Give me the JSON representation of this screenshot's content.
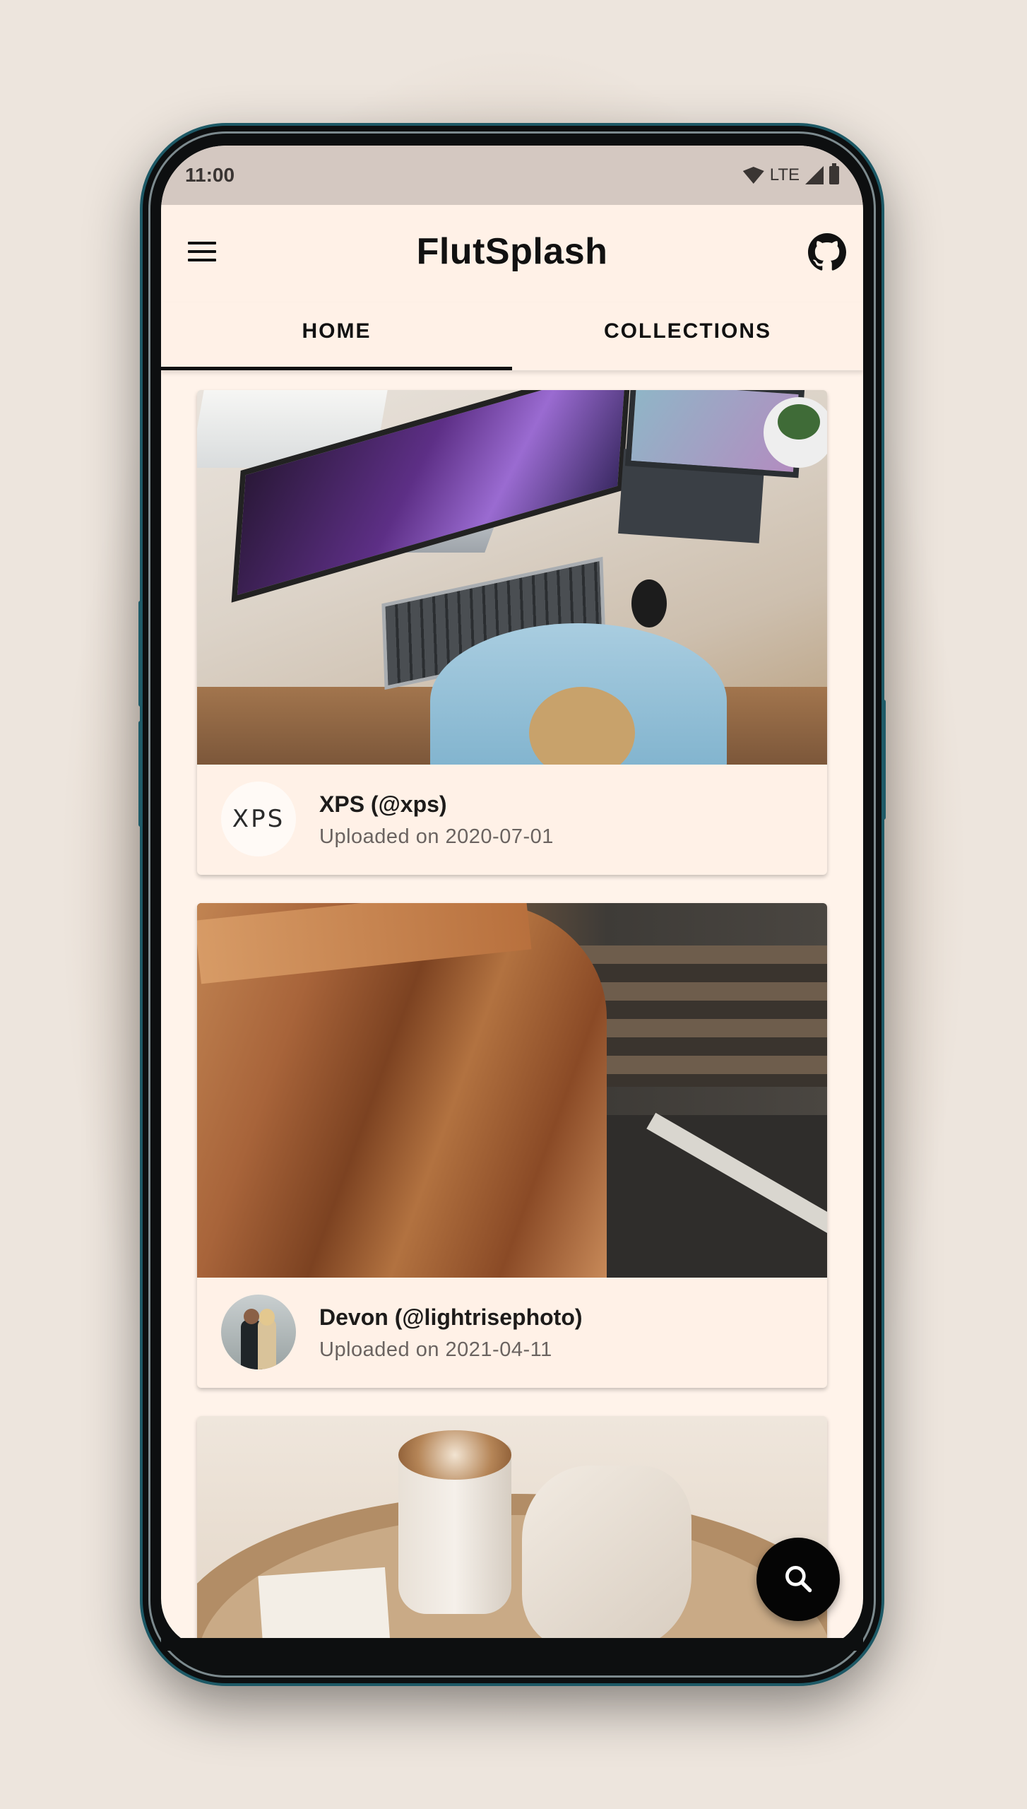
{
  "status_bar": {
    "time": "11:00",
    "network": "LTE"
  },
  "app_bar": {
    "title": "FlutSplash",
    "menu_icon": "hamburger-menu-icon",
    "github_icon": "github-icon"
  },
  "tabs": [
    {
      "label": "HOME",
      "active": true
    },
    {
      "label": "COLLECTIONS",
      "active": false
    }
  ],
  "photos": [
    {
      "author": "XPS (@xps)",
      "uploaded": "Uploaded on 2020-07-01",
      "avatar_text": "XPS",
      "image": "desk-with-monitor-and-laptop"
    },
    {
      "author": "Devon (@lightrisephoto)",
      "uploaded": "Uploaded on 2021-04-11",
      "image": "woman-in-brown-coat"
    },
    {
      "image": "coffee-tray"
    }
  ],
  "fab": {
    "icon": "search-icon"
  },
  "colors": {
    "app_background": "#fff3ea",
    "accent": "#000000",
    "status_bar": "#d4c8c1"
  }
}
